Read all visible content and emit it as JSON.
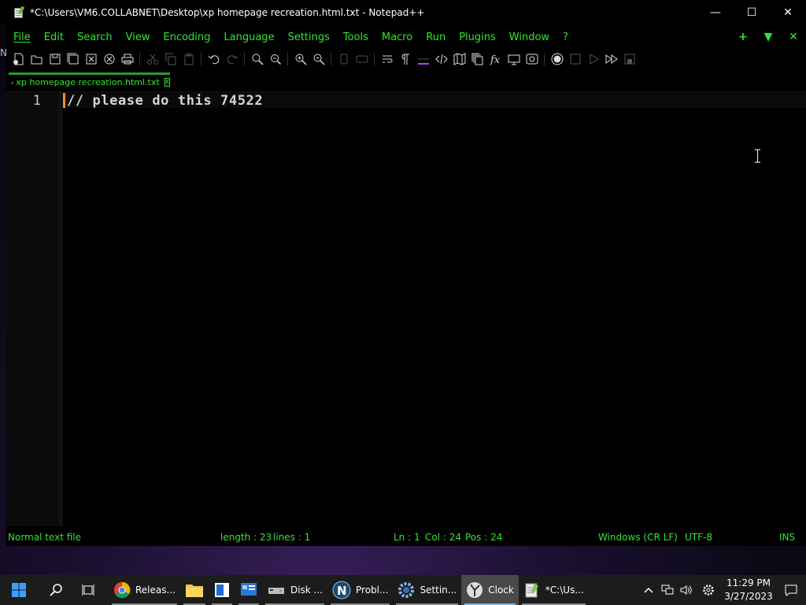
{
  "window": {
    "title": "*C:\\Users\\VM6.COLLABNET\\Desktop\\xp homepage recreation.html.txt - Notepad++",
    "minimize": "—",
    "maximize": "☐",
    "close": "✕"
  },
  "desktop": {
    "peek_char": "N"
  },
  "menu": {
    "items": [
      "File",
      "Edit",
      "Search",
      "View",
      "Encoding",
      "Language",
      "Settings",
      "Tools",
      "Macro",
      "Run",
      "Plugins",
      "Window",
      "?"
    ],
    "right_buttons": [
      "+",
      "▼",
      "✕"
    ]
  },
  "toolbar": {
    "icons": [
      "new-file-icon",
      "open-file-icon",
      "save-icon",
      "save-all-icon",
      "close-icon",
      "close-all-icon",
      "print-icon",
      "cut-icon",
      "copy-icon",
      "paste-icon",
      "undo-icon",
      "redo-icon",
      "find-icon",
      "replace-icon",
      "zoom-in-icon",
      "zoom-out-icon",
      "sync-vertical-icon",
      "sync-horizontal-icon",
      "word-wrap-icon",
      "show-all-chars-icon",
      "indent-guide-icon",
      "xml-tag-icon",
      "document-map-icon",
      "document-list-icon",
      "function-list-icon",
      "folder-as-workspace-icon",
      "monitoring-icon",
      "record-macro-icon",
      "stop-macro-icon",
      "play-macro-icon",
      "run-macro-multiple-icon",
      "save-macro-icon"
    ]
  },
  "tab": {
    "label": "xp homepage recreation.html.txt",
    "close": "x"
  },
  "editor": {
    "line_number": "1",
    "line_text": "// please do this 74522"
  },
  "status": {
    "file_type": "Normal text file",
    "length": "length : 23",
    "lines": "lines : 1",
    "ln": "Ln : 1",
    "col": "Col : 24",
    "pos": "Pos : 24",
    "eol": "Windows (CR LF)",
    "encoding": "UTF-8",
    "mode": "INS"
  },
  "taskbar": {
    "apps": [
      {
        "name": "chrome",
        "label": "Releas..."
      },
      {
        "name": "file-explorer",
        "label": ""
      },
      {
        "name": "notepad-blue",
        "label": ""
      },
      {
        "name": "control-panel",
        "label": ""
      },
      {
        "name": "disk",
        "label": "Disk ..."
      },
      {
        "name": "problem",
        "label": "Probl..."
      },
      {
        "name": "settings",
        "label": "Settin..."
      },
      {
        "name": "clock",
        "label": "Clock"
      },
      {
        "name": "notepadpp",
        "label": "*C:\\Us..."
      }
    ],
    "time": "11:29 PM",
    "date": "3/27/2023"
  },
  "colors": {
    "accent_green": "#2ee62e",
    "caret": "#ff8c1a",
    "background": "#000000"
  }
}
